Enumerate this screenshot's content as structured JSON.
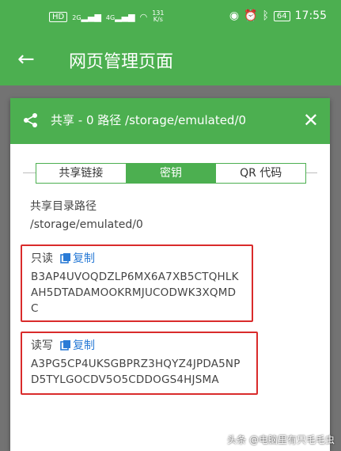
{
  "status_bar": {
    "hd": "HD",
    "net1": "2G",
    "net2": "4G",
    "speed_value": "131",
    "speed_unit": "K/s",
    "battery": "64",
    "time": "17:55"
  },
  "app_bar": {
    "title": "网页管理页面"
  },
  "dialog": {
    "title": "共享 - 0 路径 /storage/emulated/0",
    "tabs": [
      {
        "label": "共享链接"
      },
      {
        "label": "密钥"
      },
      {
        "label": "QR 代码"
      }
    ],
    "path_label": "共享目录路径",
    "path_value": "/storage/emulated/0",
    "read_only": {
      "label": "只读",
      "copy": "复制",
      "key_line1": "B3AP4UVOQDZLP6MX6A7XB5CTQHLK",
      "key_line2": "AH5DTADAMOOKRMJUCODWK3XQMD",
      "key_line3": "C"
    },
    "read_write": {
      "label": "读写",
      "copy": "复制",
      "key_line1": "A3PG5CP4UKSGBPRZ3HQYZ4JPDA5NP",
      "key_line2": "D5TYLGOCDV5O5CDDOGS4HJSMA"
    }
  },
  "watermark": "头条 @电脑里有只毛毛虫",
  "colors": {
    "primary": "#4caf50",
    "highlight": "#d92b2b",
    "link": "#2a7bd6"
  }
}
